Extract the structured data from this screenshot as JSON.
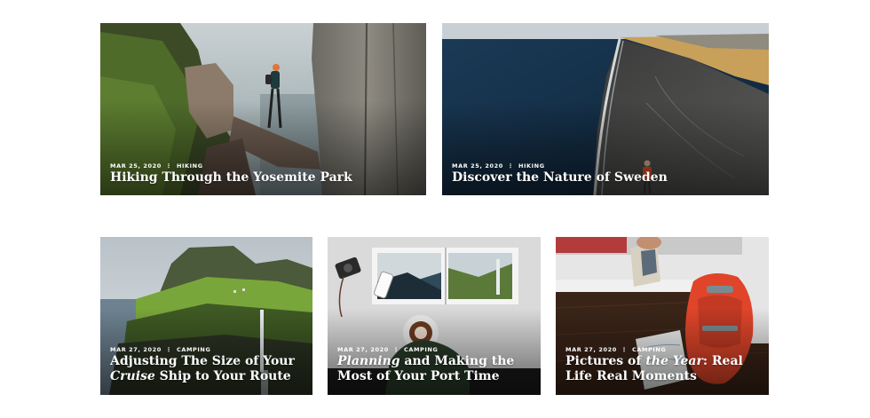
{
  "cards": [
    {
      "date": "MAR 25, 2020",
      "category": "HIKING",
      "title": "Hiking Through the Yosemite Park"
    },
    {
      "date": "MAR 25, 2020",
      "category": "HIKING",
      "title": "Discover the Nature of Sweden"
    },
    {
      "date": "MAR 27, 2020",
      "category": "CAMPING",
      "title_part1": "Adjusting The Size of Your",
      "title_italic": "Cruise",
      "title_part2": " Ship to Your Route"
    },
    {
      "date": "MAR 27, 2020",
      "category": "CAMPING",
      "title_italic": "Planning",
      "title_part2": " and Making the Most of Your Port Time"
    },
    {
      "date": "MAR 27, 2020",
      "category": "CAMPING",
      "title_part1": "Pictures of ",
      "title_italic": "the Year",
      "title_part2": ": Real Life Real Moments"
    }
  ],
  "meta_separator": "⋮"
}
